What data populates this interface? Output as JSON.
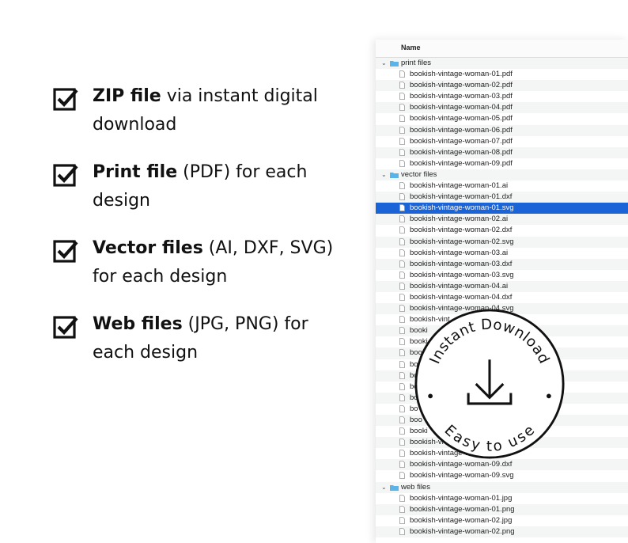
{
  "features": [
    {
      "bold": "ZIP file",
      "rest": " via instant digital download"
    },
    {
      "bold": "Print file",
      "rest": " (PDF) for each design"
    },
    {
      "bold": "Vector files",
      "rest": " (AI, DXF, SVG) for each design"
    },
    {
      "bold": "Web files",
      "rest": " (JPG, PNG) for each design"
    }
  ],
  "finder": {
    "column_name": "Name",
    "rows": [
      {
        "type": "folder",
        "label": "print files"
      },
      {
        "type": "file",
        "label": "bookish-vintage-woman-01.pdf"
      },
      {
        "type": "file",
        "label": "bookish-vintage-woman-02.pdf"
      },
      {
        "type": "file",
        "label": "bookish-vintage-woman-03.pdf"
      },
      {
        "type": "file",
        "label": "bookish-vintage-woman-04.pdf"
      },
      {
        "type": "file",
        "label": "bookish-vintage-woman-05.pdf"
      },
      {
        "type": "file",
        "label": "bookish-vintage-woman-06.pdf"
      },
      {
        "type": "file",
        "label": "bookish-vintage-woman-07.pdf"
      },
      {
        "type": "file",
        "label": "bookish-vintage-woman-08.pdf"
      },
      {
        "type": "file",
        "label": "bookish-vintage-woman-09.pdf"
      },
      {
        "type": "folder",
        "label": "vector files"
      },
      {
        "type": "file",
        "label": "bookish-vintage-woman-01.ai"
      },
      {
        "type": "file",
        "label": "bookish-vintage-woman-01.dxf"
      },
      {
        "type": "file",
        "label": "bookish-vintage-woman-01.svg",
        "selected": true
      },
      {
        "type": "file",
        "label": "bookish-vintage-woman-02.ai"
      },
      {
        "type": "file",
        "label": "bookish-vintage-woman-02.dxf"
      },
      {
        "type": "file",
        "label": "bookish-vintage-woman-02.svg"
      },
      {
        "type": "file",
        "label": "bookish-vintage-woman-03.ai"
      },
      {
        "type": "file",
        "label": "bookish-vintage-woman-03.dxf"
      },
      {
        "type": "file",
        "label": "bookish-vintage-woman-03.svg"
      },
      {
        "type": "file",
        "label": "bookish-vintage-woman-04.ai"
      },
      {
        "type": "file",
        "label": "bookish-vintage-woman-04.dxf"
      },
      {
        "type": "file",
        "label": "bookish-vintage-woman-04.svg"
      },
      {
        "type": "file",
        "label": "bookish-vint"
      },
      {
        "type": "file",
        "label": "booki"
      },
      {
        "type": "file",
        "label": "booki"
      },
      {
        "type": "file",
        "label": "boo"
      },
      {
        "type": "file",
        "label": "boo"
      },
      {
        "type": "file",
        "label": "bo"
      },
      {
        "type": "file",
        "label": "bo"
      },
      {
        "type": "file",
        "label": "bo"
      },
      {
        "type": "file",
        "label": "bo"
      },
      {
        "type": "file",
        "label": "boo"
      },
      {
        "type": "file",
        "label": "booki"
      },
      {
        "type": "file",
        "label": "bookish-vi"
      },
      {
        "type": "file",
        "label": "bookish-vintage-w"
      },
      {
        "type": "file",
        "label": "bookish-vintage-woman-09.dxf"
      },
      {
        "type": "file",
        "label": "bookish-vintage-woman-09.svg"
      },
      {
        "type": "folder",
        "label": "web files"
      },
      {
        "type": "file",
        "label": "bookish-vintage-woman-01.jpg"
      },
      {
        "type": "file",
        "label": "bookish-vintage-woman-01.png"
      },
      {
        "type": "file",
        "label": "bookish-vintage-woman-02.jpg"
      },
      {
        "type": "file",
        "label": "bookish-vintage-woman-02.png"
      }
    ]
  },
  "badge": {
    "top_text": "Instant Download",
    "bottom_text": "Easy to use",
    "icon": "download-icon"
  },
  "colors": {
    "selection": "#1a64d8",
    "folder": "#5ab4ea",
    "stripe": "#f4f5f5"
  }
}
